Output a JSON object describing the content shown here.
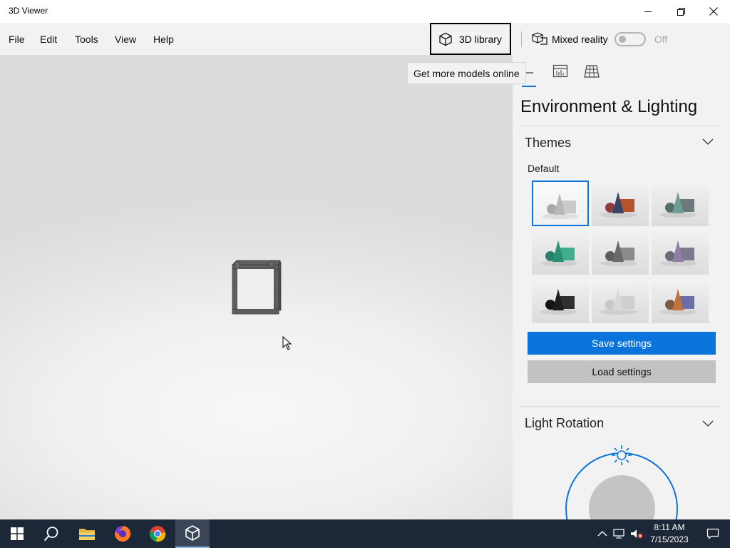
{
  "window": {
    "title": "3D Viewer"
  },
  "menu": {
    "items": [
      "File",
      "Edit",
      "Tools",
      "View",
      "Help"
    ]
  },
  "toolbar": {
    "library_label": "3D library",
    "mixed_reality_label": "Mixed reality",
    "mixed_reality_state": "Off"
  },
  "tooltip": {
    "text": "Get more models online"
  },
  "panel": {
    "title": "Environment & Lighting",
    "themes": {
      "title": "Themes",
      "selected_label": "Default",
      "swatches": [
        {
          "name": "default",
          "colors": [
            "#b8b8b8",
            "#c9c9c9",
            "#a9a9a9"
          ]
        },
        {
          "name": "warm",
          "colors": [
            "#3a4467",
            "#b5532f",
            "#8a3e3e"
          ]
        },
        {
          "name": "teal",
          "colors": [
            "#6f9e97",
            "#6a7a7a",
            "#54706c"
          ]
        },
        {
          "name": "green",
          "colors": [
            "#2b8f74",
            "#3fae8c",
            "#27806a"
          ]
        },
        {
          "name": "gray",
          "colors": [
            "#6a6a6a",
            "#8a8a8a",
            "#5c5c5c"
          ]
        },
        {
          "name": "purple",
          "colors": [
            "#8f7fa8",
            "#7a7a8c",
            "#6c6c78"
          ]
        },
        {
          "name": "dark",
          "colors": [
            "#1e1e1e",
            "#2f2f2f",
            "#141414"
          ]
        },
        {
          "name": "light",
          "colors": [
            "#d8d8d8",
            "#cfcfcf",
            "#c8c8c8"
          ]
        },
        {
          "name": "sunset",
          "colors": [
            "#c0733a",
            "#6b6fa8",
            "#7d5a44"
          ]
        }
      ]
    },
    "save_label": "Save settings",
    "load_label": "Load settings",
    "light_rotation_title": "Light Rotation"
  },
  "colors": {
    "accent": "#0a74da",
    "taskbar": "#1c2738",
    "panel_bg": "#f2f2f2"
  },
  "taskbar": {
    "apps": [
      "start-icon",
      "search-icon",
      "file-explorer-icon",
      "firefox-icon",
      "chrome-icon",
      "3d-viewer-icon"
    ],
    "time": "8:11 AM",
    "date": "7/15/2023"
  }
}
